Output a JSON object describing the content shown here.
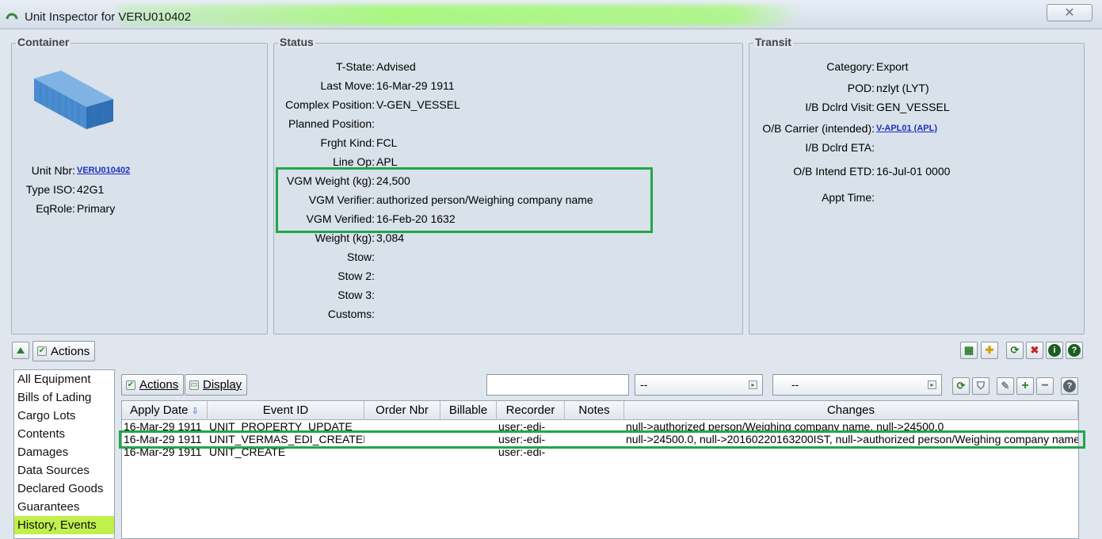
{
  "window": {
    "title": "Unit Inspector for VERU010402",
    "close_glyph": "✕"
  },
  "container": {
    "heading": "Container",
    "image_icon": "shipping-container-icon",
    "unit_nbr_label": "Unit Nbr:",
    "unit_nbr_value": "VERU010402",
    "type_iso_label": "Type ISO:",
    "type_iso_value": "42G1",
    "eqrole_label": "EqRole:",
    "eqrole_value": "Primary"
  },
  "status": {
    "heading": "Status",
    "rows": [
      {
        "label": "T-State:",
        "value": "Advised"
      },
      {
        "label": "Last Move:",
        "value": "16-Mar-29 1911"
      },
      {
        "label": "Complex Position:",
        "value": "V-GEN_VESSEL"
      },
      {
        "label": "Planned Position:",
        "value": ""
      },
      {
        "label": "Frght Kind:",
        "value": "FCL"
      },
      {
        "label": "Line Op:",
        "value": "APL"
      },
      {
        "label": "VGM Weight (kg):",
        "value": "24,500"
      },
      {
        "label": "VGM Verifier:",
        "value": "authorized person/Weighing company name"
      },
      {
        "label": "VGM Verified:",
        "value": "16-Feb-20 1632"
      },
      {
        "label": "Weight (kg):",
        "value": "3,084"
      },
      {
        "label": "Stow:",
        "value": ""
      },
      {
        "label": "Stow 2:",
        "value": ""
      },
      {
        "label": "Stow 3:",
        "value": ""
      },
      {
        "label": "Customs:",
        "value": ""
      }
    ]
  },
  "transit": {
    "heading": "Transit",
    "rows": [
      {
        "label": "Category:",
        "value": "Export"
      },
      {
        "label": "POD:",
        "value": "nzlyt (LYT)"
      },
      {
        "label": "I/B Dclrd Visit:",
        "value": "GEN_VESSEL"
      },
      {
        "label": "O/B Carrier (intended):",
        "value": "V-APL01 (APL)"
      },
      {
        "label": "I/B Dclrd ETA:",
        "value": ""
      },
      {
        "label": "O/B Intend ETD:",
        "value": "16-Jul-01 0000"
      },
      {
        "label": "Appt Time:",
        "value": ""
      }
    ]
  },
  "toolbar": {
    "actions_label": "Actions"
  },
  "sidebar": {
    "items": [
      "All Equipment",
      "Bills of Lading",
      "Cargo Lots",
      "Contents",
      "Damages",
      "Data Sources",
      "Declared Goods",
      "Guarantees",
      "History, Events"
    ]
  },
  "events": {
    "actions_label": "Actions",
    "display_label": "Display",
    "filter_value": "",
    "combo1_value": "--",
    "combo2_value": "--",
    "columns": [
      "Apply Date",
      "Event ID",
      "Order Nbr",
      "Billable",
      "Recorder",
      "Notes",
      "Changes"
    ],
    "rows": [
      {
        "date": "16-Mar-29 1911",
        "event": "UNIT_PROPERTY_UPDATE",
        "order": "",
        "billable": "",
        "recorder": "user:-edi-",
        "notes": "",
        "changes": "null->authorized person/Weighing company name, null->24500.0"
      },
      {
        "date": "16-Mar-29 1911",
        "event": "UNIT_VERMAS_EDI_CREATED",
        "order": "",
        "billable": "",
        "recorder": "user:-edi-",
        "notes": "",
        "changes": "null->24500.0, null->20160220163200IST, null->authorized person/Weighing company name"
      },
      {
        "date": "16-Mar-29 1911",
        "event": "UNIT_CREATE",
        "order": "",
        "billable": "",
        "recorder": "user:-edi-",
        "notes": "",
        "changes": ""
      }
    ]
  },
  "colors": {
    "highlight": "#22a54a",
    "selected_item": "#bff04c",
    "link": "#1c2fbf"
  }
}
